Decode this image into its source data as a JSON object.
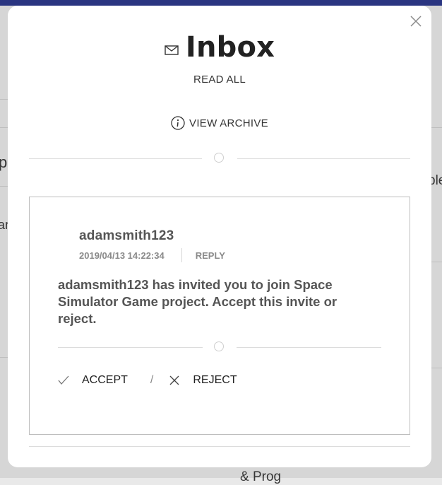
{
  "modal": {
    "title": "Inbox",
    "read_all_label": "READ ALL",
    "view_archive_label": "VIEW ARCHIVE"
  },
  "message": {
    "sender": "adamsmith123",
    "timestamp": "2019/04/13 14:22:34",
    "reply_label": "REPLY",
    "body": "adamsmith123 has invited you to join Space Simulator Game project. Accept this invite or reject.",
    "accept_label": "ACCEPT",
    "separator": "/",
    "reject_label": "REJECT"
  },
  "background": {
    "frag_left_1": "p",
    "frag_left_2": "ar",
    "frag_right_1": "ble",
    "frag_bottom": "& Prog"
  },
  "colors": {
    "topbar": "#2e3a8c",
    "modal_bg": "#ffffff",
    "card_border": "#bdbdbd"
  }
}
